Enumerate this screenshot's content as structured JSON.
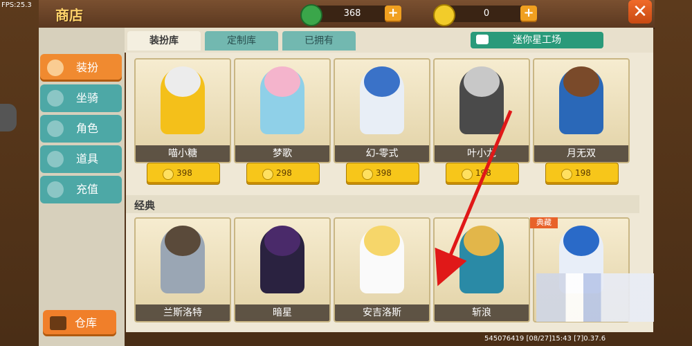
{
  "fps": "FPS:25.3",
  "shop_title": "商店",
  "currency": [
    {
      "icon": "green-gem-icon",
      "value": "368",
      "add": "+"
    },
    {
      "icon": "gold-coin-icon",
      "value": "0",
      "add": "+"
    }
  ],
  "close_symbol": "✕",
  "tabs": [
    {
      "label": "装扮库",
      "active": true
    },
    {
      "label": "定制库",
      "active": false
    },
    {
      "label": "已拥有",
      "active": false
    }
  ],
  "factory_button": "迷你星工场",
  "sidebar": [
    {
      "label": "装扮",
      "icon": "outfit-icon",
      "active": true
    },
    {
      "label": "坐骑",
      "icon": "mount-icon",
      "active": false
    },
    {
      "label": "角色",
      "icon": "character-icon",
      "active": false
    },
    {
      "label": "道具",
      "icon": "item-icon",
      "active": false
    },
    {
      "label": "充值",
      "icon": "recharge-icon",
      "active": false
    }
  ],
  "warehouse_button": "仓库",
  "row1": [
    {
      "name": "喵小糖",
      "price": "398"
    },
    {
      "name": "梦歌",
      "price": "298"
    },
    {
      "name": "幻-零式",
      "price": "398"
    },
    {
      "name": "叶小龙",
      "price": "198"
    },
    {
      "name": "月无双",
      "price": "198"
    }
  ],
  "section_title": "经典",
  "row2": [
    {
      "name": "兰斯洛特"
    },
    {
      "name": "暗星"
    },
    {
      "name": "安吉洛斯"
    },
    {
      "name": "斩浪"
    },
    {
      "name": ""
    }
  ],
  "badge": "典藏",
  "footer": {
    "uid": "545076419",
    "date": "[08/27]15:43",
    "ver": "[7]0.37.6"
  },
  "colors": {
    "accent": "#f08a30",
    "teal": "#4da8a6",
    "arrow": "#e01818"
  }
}
